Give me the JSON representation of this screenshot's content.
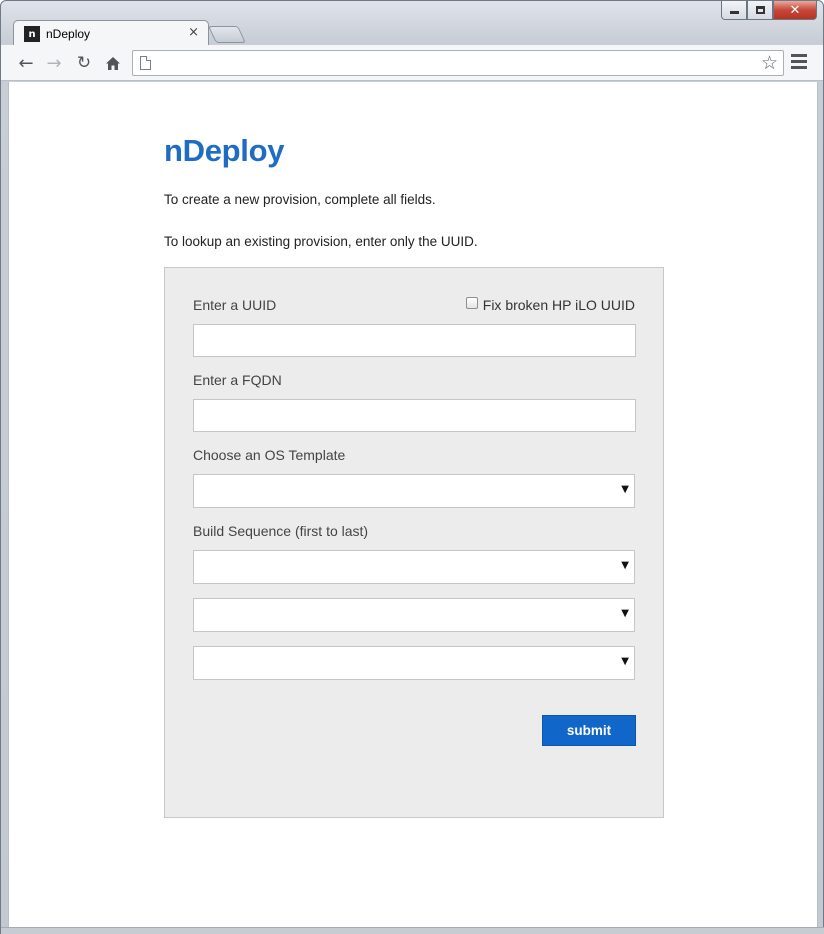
{
  "browser": {
    "tab_title": "nDeploy",
    "tab_favicon_letter": "n",
    "tab_close_glyph": "×",
    "address_value": "",
    "icons": [
      "back-icon",
      "forward-icon",
      "reload-icon",
      "home-icon",
      "page-icon",
      "star-icon",
      "menu-icon"
    ]
  },
  "window": {
    "close_glyph": "✕"
  },
  "page": {
    "brand": "nDeploy",
    "intro_create": "To create a new provision, complete all fields.",
    "intro_lookup": "To lookup an existing provision, enter only the UUID.",
    "form": {
      "uuid_label": "Enter a UUID",
      "uuid_value": "",
      "fix_checkbox_label": "Fix broken HP iLO UUID",
      "fix_checkbox_checked": false,
      "fqdn_label": "Enter a FQDN",
      "fqdn_value": "",
      "os_template_label": "Choose an OS Template",
      "os_template_selected": "",
      "build_sequence_label": "Build Sequence (first to last)",
      "build_sequence_selected": [
        "",
        "",
        ""
      ],
      "submit_label": "submit"
    },
    "colors": {
      "brand": "#1f6dc2",
      "submit": "#1166c9",
      "panel": "#ececec"
    }
  }
}
